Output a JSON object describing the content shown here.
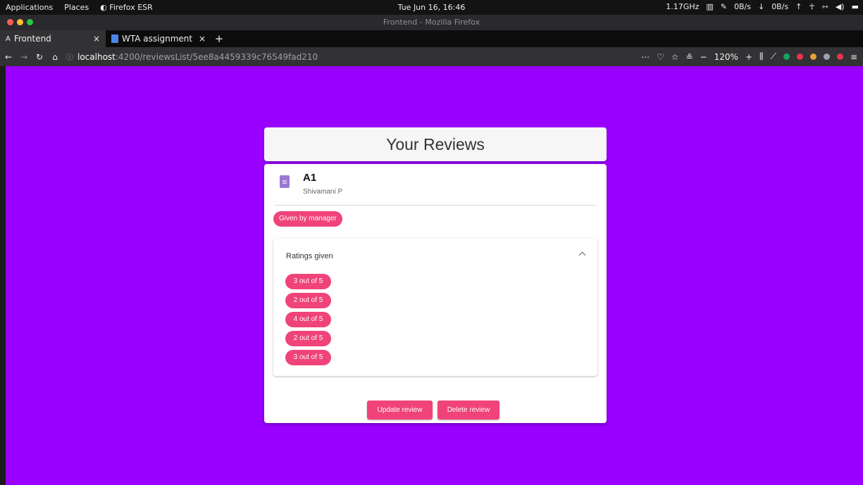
{
  "system": {
    "applications": "Applications",
    "places": "Places",
    "active_app": "Firefox ESR",
    "clock": "Tue Jun 16, 16:46",
    "cpu": "1.17GHz",
    "net_down": "0B/s",
    "net_up": "0B/s"
  },
  "window": {
    "title": "Frontend - Mozilla Firefox"
  },
  "tabs": [
    {
      "label": "Frontend"
    },
    {
      "label": "WTA assignment"
    }
  ],
  "navbar": {
    "url_host": "localhost",
    "url_path": ":4200/reviewsList/5ee8a4459339c76549fad210",
    "zoom": "120%"
  },
  "page": {
    "heading": "Your Reviews",
    "review": {
      "title": "A1",
      "subtitle": "Shivamani P",
      "badge": "Given by manager",
      "ratings_title": "Ratings given",
      "ratings": [
        "3 out of 5",
        "2 out of 5",
        "4 out of 5",
        "2 out of 5",
        "3 out of 5"
      ],
      "update_label": "Update review",
      "delete_label": "Delete review"
    }
  },
  "colors": {
    "page_background": "#9900ff",
    "accent": "#f0437a"
  }
}
